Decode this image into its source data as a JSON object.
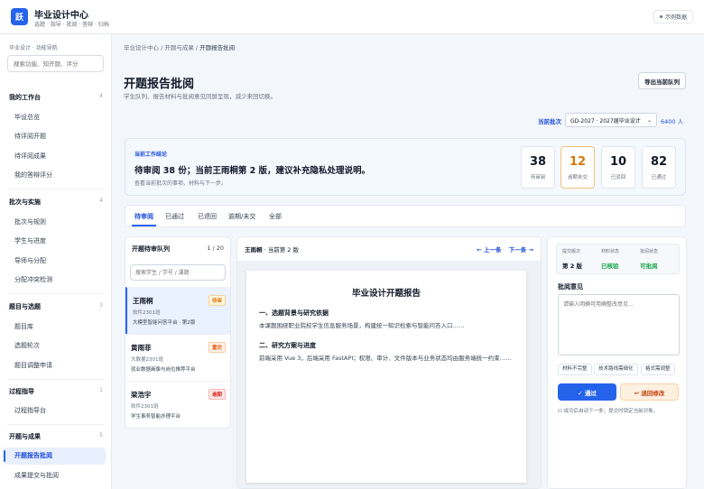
{
  "header": {
    "logo_text": "跃",
    "title": "毕业设计中心",
    "subtitle": "选题 · 指导 · 批阅 · 答辩 · 归档",
    "sample_label": "示例数据"
  },
  "sidebar": {
    "title": "毕业设计 · 功能导航",
    "search_placeholder": "搜索功能、知开题、评分",
    "groups": [
      {
        "label": "我的工作台",
        "count": "4",
        "items": [
          "毕设总览",
          "待评阅开题",
          "待评阅成果",
          "我的答辩评分"
        ]
      },
      {
        "label": "批次与实施",
        "count": "4",
        "items": [
          "批次与规则",
          "学生与进度",
          "导师与分配",
          "分配冲突检测"
        ]
      },
      {
        "label": "题目与选题",
        "count": "3",
        "items": [
          "题目库",
          "选题轮次",
          "题目调整申请"
        ]
      },
      {
        "label": "过程指导",
        "count": "1",
        "items": [
          "过程指导台"
        ]
      },
      {
        "label": "开题与成果",
        "count": "5",
        "items": [
          "开题报告批阅",
          "成果提交与批阅"
        ]
      }
    ]
  },
  "breadcrumb": {
    "path": "毕业设计中心 / 开题与成果 / ",
    "current": "开题报告批阅"
  },
  "page": {
    "title": "开题报告批阅",
    "subtitle": "学生队列、报告材料与批阅意见同屏呈现，减少来回切换。",
    "export_label": "导出当前队列"
  },
  "batch": {
    "label": "当前批次",
    "value": "GD-2027 · 2027届毕业设计",
    "count": "6400 人"
  },
  "summary": {
    "label": "当前工作结论",
    "text": "待审阅 38 份；当前王雨桐第 2 版，建议补充隐私处理说明。",
    "sub": "查看当前批次的事项、材料与下一步。",
    "stats": [
      {
        "num": "38",
        "label": "待审阅"
      },
      {
        "num": "12",
        "label": "逾期未交"
      },
      {
        "num": "10",
        "label": "已驳回"
      },
      {
        "num": "82",
        "label": "已通过"
      }
    ]
  },
  "tabs": [
    "待审阅",
    "已通过",
    "已退回",
    "逾期/未交",
    "全部"
  ],
  "queue": {
    "title": "开题待审队列",
    "count": "1 / 20",
    "search_placeholder": "搜索学生 / 学号 / 课题",
    "items": [
      {
        "name": "王雨桐",
        "badge": "待审",
        "class": "软件2301班",
        "topic": "大模型智能问答平台 · 第2版"
      },
      {
        "name": "黄雨菲",
        "badge": "重交",
        "class": "大数据2301班",
        "topic": "就业数据画像与岗位推荐平台"
      },
      {
        "name": "梁浩宇",
        "badge": "逾期",
        "class": "软件2301班",
        "topic": "学生事务智能办理平台"
      }
    ]
  },
  "viewer": {
    "student": "王雨桐",
    "version": " · 当前第 2 版",
    "prev": "← 上一条",
    "next": "下一条 →",
    "doc_title": "毕业设计开题报告",
    "sections": [
      {
        "heading": "一、选题背景与研究依据",
        "text": "本课题围绕职业院校学生信息服务场景，构建统一知识检索与智能问答入口……"
      },
      {
        "heading": "二、研究方案与进度",
        "text": "前端采用 Vue 3，后端采用 FastAPI；权限、审计、文件版本与业务状态均由服务端统一约束……"
      }
    ]
  },
  "review": {
    "info": [
      {
        "label": "提交版次",
        "value": "第 2 版",
        "color": "#111827"
      },
      {
        "label": "材料状态",
        "value": "已核验",
        "color": "#16a34a"
      },
      {
        "label": "批阅状态",
        "value": "可批阅",
        "color": "#16a34a"
      }
    ],
    "title": "批阅意见",
    "placeholder": "请输入明确可用确整改意见…",
    "chips": [
      "材料不完整",
      "技术路线需细化",
      "格式需调整"
    ],
    "pass_label": "✓ 通过",
    "return_label": "↩ 退回修改",
    "note": "☑ 成功后自动下一条；提交时锁定当前对象。"
  }
}
